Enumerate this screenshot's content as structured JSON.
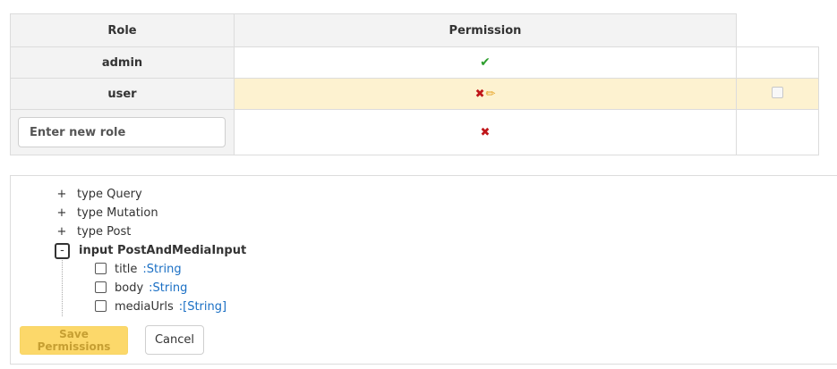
{
  "table": {
    "headers": {
      "role": "Role",
      "permission": "Permission"
    },
    "rows": [
      {
        "role": "admin",
        "permission_icon": "check-icon",
        "permission_glyph": "✔"
      },
      {
        "role": "user",
        "permission_icon": "cross-icon",
        "permission_glyph": "✖",
        "edit_icon": "pencil-icon",
        "edit_glyph": "✏"
      }
    ],
    "new_role": {
      "placeholder": "Enter new role",
      "value": "",
      "permission_icon": "cross-icon",
      "permission_glyph": "✖"
    }
  },
  "schema": {
    "nodes": [
      {
        "toggle": "+",
        "label": "type Query"
      },
      {
        "toggle": "+",
        "label": "type Mutation"
      },
      {
        "toggle": "+",
        "label": "type Post"
      },
      {
        "toggle": "-",
        "label": "input PostAndMediaInput"
      }
    ],
    "fields": [
      {
        "name": "title",
        "type": ":String"
      },
      {
        "name": "body",
        "type": ":String"
      },
      {
        "name": "mediaUrls",
        "type": ":[String]"
      }
    ]
  },
  "actions": {
    "save_label": "Save Permissions",
    "cancel_label": "Cancel"
  },
  "colors": {
    "highlight_row": "#fdf2d0",
    "save_button": "#fcd663",
    "type_link": "#1a6fc4",
    "check": "#2e9e2e",
    "cross": "#c0161a"
  }
}
